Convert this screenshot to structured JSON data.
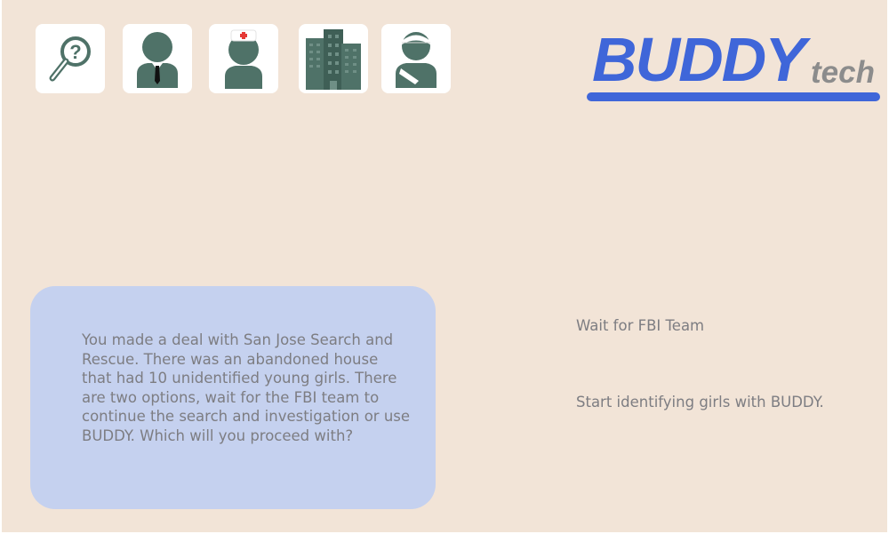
{
  "toolbar": {
    "icons": [
      {
        "name": "search-help-icon"
      },
      {
        "name": "agent-icon"
      },
      {
        "name": "nurse-icon"
      },
      {
        "name": "building-icon"
      },
      {
        "name": "injured-person-icon"
      }
    ],
    "icon_color": "#4f7268"
  },
  "logo": {
    "main": "BUDDY",
    "sub": "tech",
    "brand_color": "#3f66d9",
    "sub_color": "#8c8c8c"
  },
  "story": {
    "text": "You made a deal with San Jose Search and Rescue. There was an abandoned house that had 10 unidentified young girls. There are two options, wait for the FBI team to continue the search and investigation or use BUDDY. Which will you proceed with?"
  },
  "choices": [
    {
      "label": "Wait for FBI Team"
    },
    {
      "label": "Start identifying girls with BUDDY."
    }
  ],
  "colors": {
    "background": "#f2e4d7",
    "card": "#c5d1ef",
    "text": "#7d7d82"
  }
}
